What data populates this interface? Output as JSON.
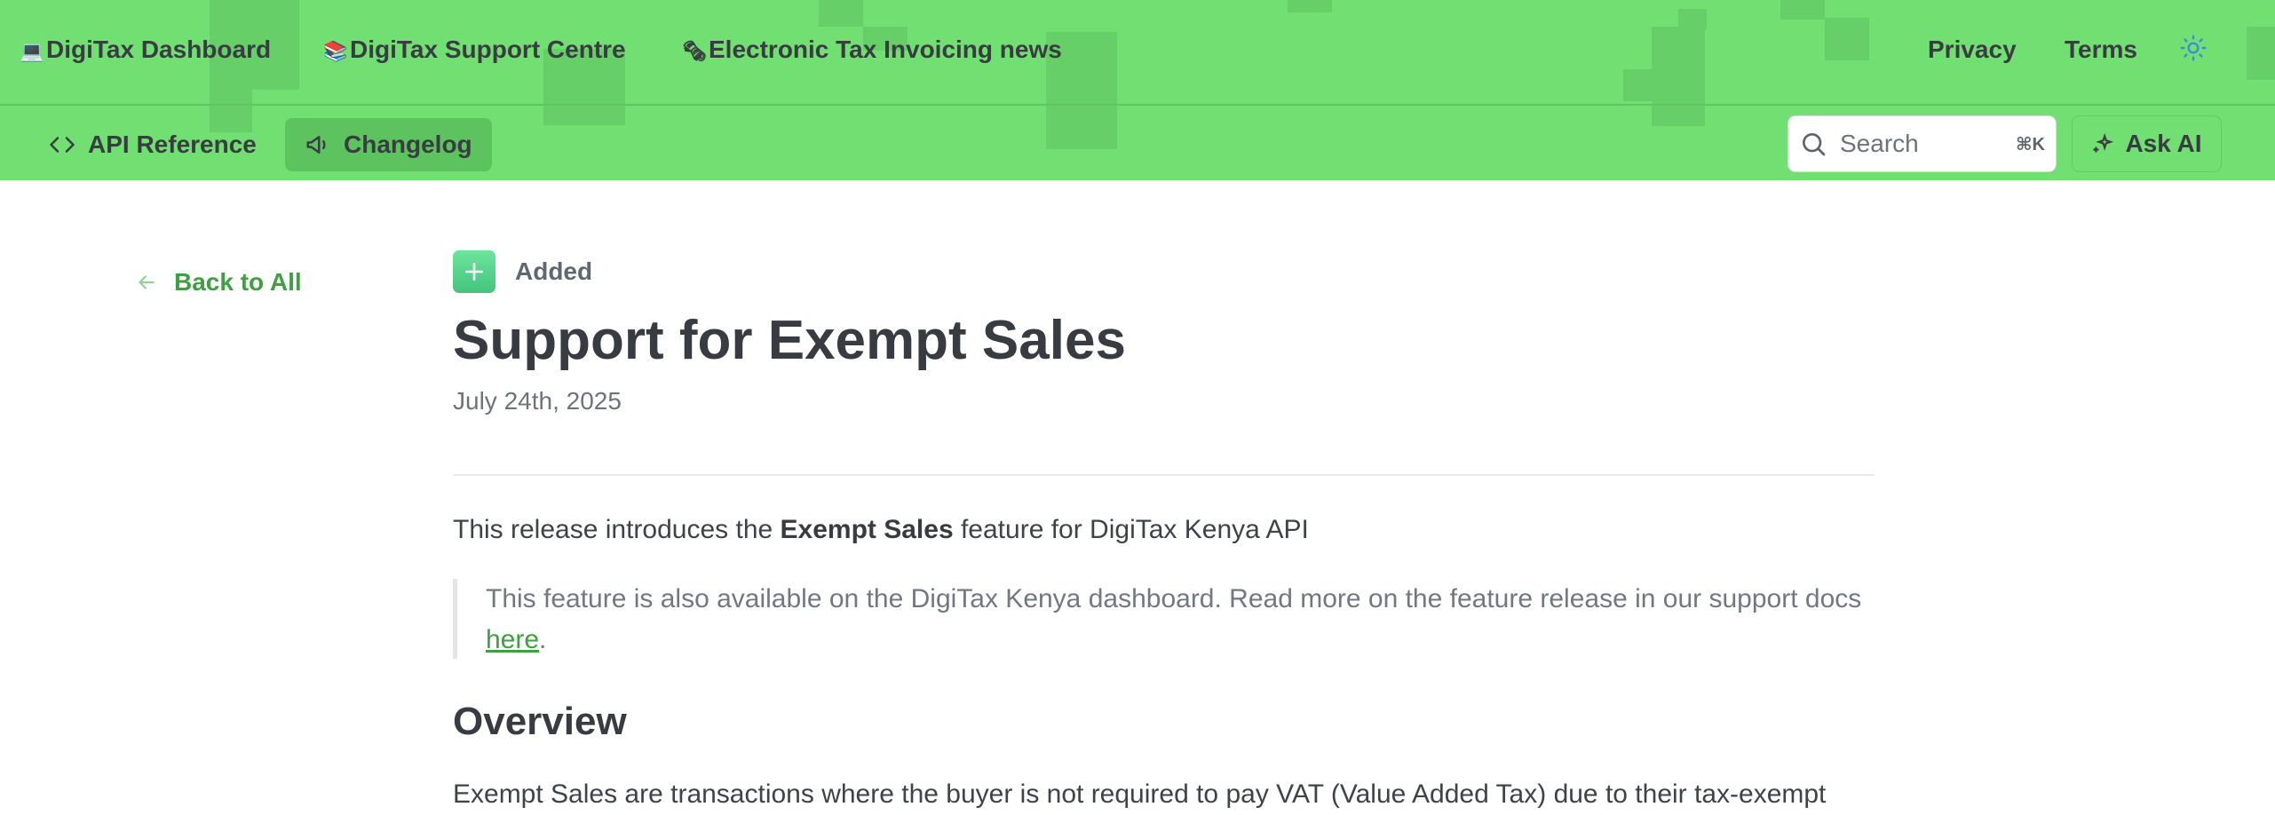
{
  "topnav": {
    "links": [
      {
        "emoji": "💻",
        "label": "DigiTax Dashboard"
      },
      {
        "emoji": "📚",
        "label": "DigiTax Support Centre"
      },
      {
        "emoji": "🗞",
        "label": "Electronic Tax Invoicing news"
      }
    ],
    "privacy": "Privacy",
    "terms": "Terms"
  },
  "subnav": {
    "api_reference": "API Reference",
    "changelog": "Changelog"
  },
  "search": {
    "placeholder": "Search",
    "shortcut": "⌘K"
  },
  "ask_ai": "Ask AI",
  "back_link": "Back to All",
  "entry": {
    "badge": "Added",
    "title": "Support for Exempt Sales",
    "date": "July 24th, 2025",
    "intro_before": "This release introduces the ",
    "intro_bold": "Exempt Sales",
    "intro_after": " feature for DigiTax Kenya API",
    "quote_text": "This feature is also available on the DigiTax Kenya dashboard. Read more on the feature release in our support docs ",
    "quote_link": "here",
    "quote_end": ".",
    "overview_heading": "Overview",
    "overview_text": "Exempt Sales are transactions where the buyer is not required to pay VAT (Value Added Tax) due to their tax-exempt"
  },
  "colors": {
    "header_bg": "#72df73",
    "accent_green": "#3f9f43",
    "badge_green": "#43c47e"
  }
}
